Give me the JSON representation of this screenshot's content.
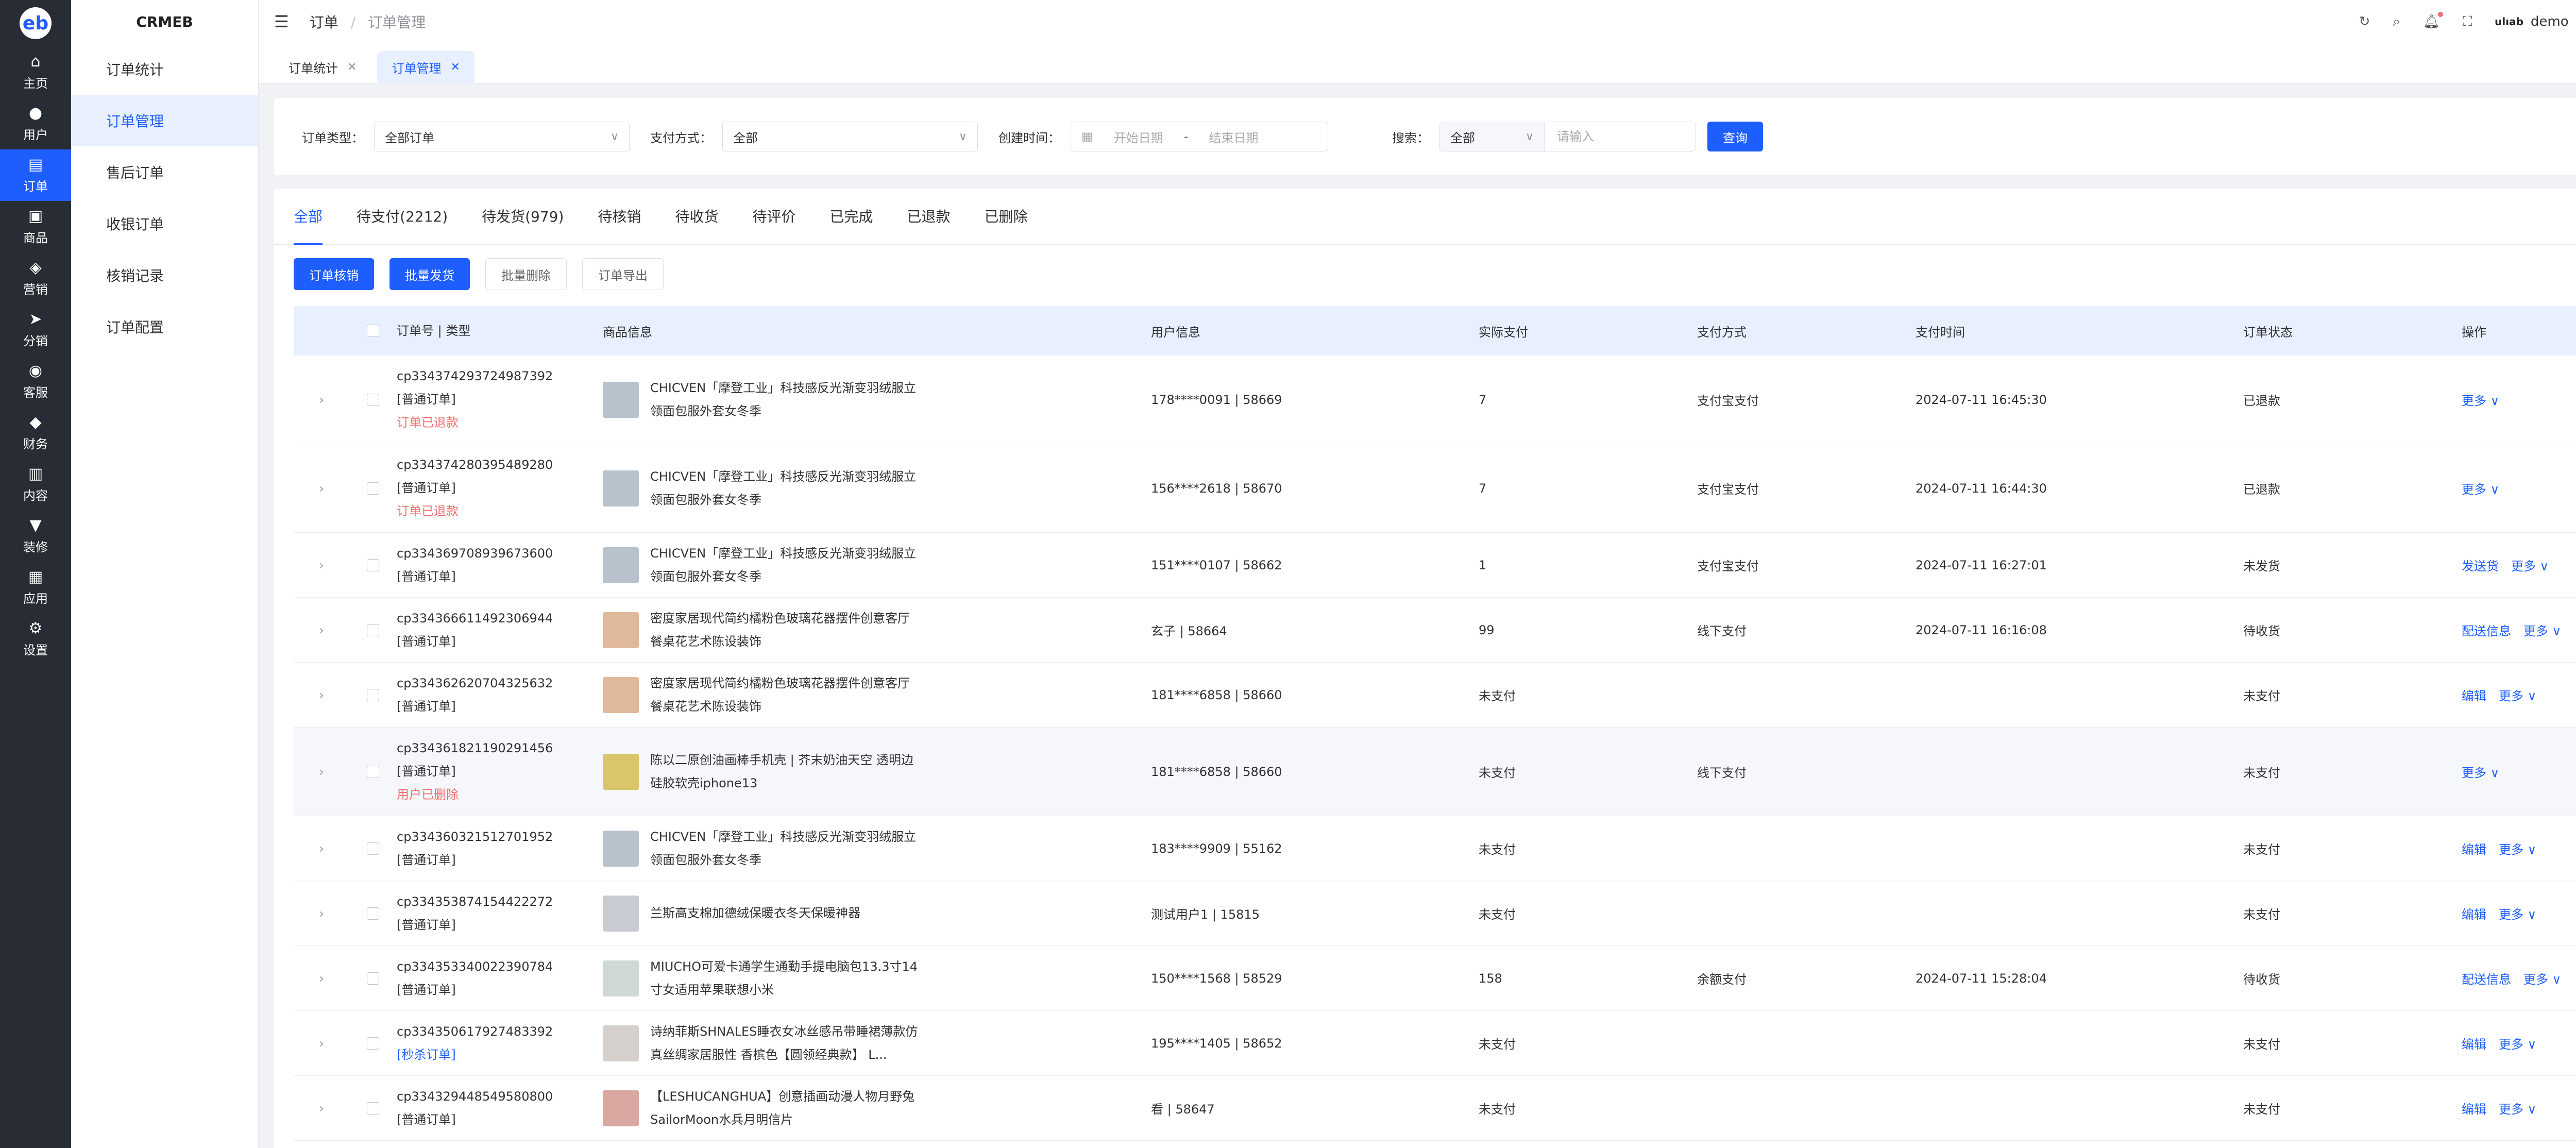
{
  "app": {
    "brand": "CRMEB",
    "logo": "eb"
  },
  "rail": [
    {
      "label": "主页",
      "icon": "⌂",
      "name": "home"
    },
    {
      "label": "用户",
      "icon": "●",
      "name": "user"
    },
    {
      "label": "订单",
      "icon": "▤",
      "name": "order"
    },
    {
      "label": "商品",
      "icon": "▣",
      "name": "goods"
    },
    {
      "label": "营销",
      "icon": "◈",
      "name": "marketing"
    },
    {
      "label": "分销",
      "icon": "➤",
      "name": "distribution"
    },
    {
      "label": "客服",
      "icon": "◉",
      "name": "service"
    },
    {
      "label": "财务",
      "icon": "◆",
      "name": "finance"
    },
    {
      "label": "内容",
      "icon": "▥",
      "name": "content"
    },
    {
      "label": "装修",
      "icon": "▼",
      "name": "decorate"
    },
    {
      "label": "应用",
      "icon": "▦",
      "name": "apps"
    },
    {
      "label": "设置",
      "icon": "⚙",
      "name": "settings"
    }
  ],
  "subnav": [
    "订单统计",
    "订单管理",
    "售后订单",
    "收银订单",
    "核销记录",
    "订单配置"
  ],
  "breadcrumb": {
    "root": "订单",
    "current": "订单管理",
    "sep": "/"
  },
  "header": {
    "username": "demo",
    "user_logo": "ulıab"
  },
  "tags": [
    {
      "label": "订单统计"
    },
    {
      "label": "订单管理"
    }
  ],
  "filter": {
    "type_label": "订单类型：",
    "type_value": "全部订单",
    "pay_label": "支付方式：",
    "pay_value": "全部",
    "time_label": "创建时间：",
    "start_placeholder": "开始日期",
    "dash": "-",
    "end_placeholder": "结束日期",
    "search_label": "搜索：",
    "search_scope": "全部",
    "search_placeholder": "请输入",
    "query_button": "查询"
  },
  "status_tabs": [
    "全部",
    "待支付(2212)",
    "待发货(979)",
    "待核销",
    "待收货",
    "待评价",
    "已完成",
    "已退款",
    "已删除"
  ],
  "buttons": {
    "verify": "订单核销",
    "batch_ship": "批量发货",
    "batch_delete": "批量删除",
    "export": "订单导出"
  },
  "columns": [
    "订单号 | 类型",
    "商品信息",
    "用户信息",
    "实际支付",
    "支付方式",
    "支付时间",
    "订单状态",
    "操作"
  ],
  "rows": [
    {
      "order": "cp334374293724987392",
      "type": "[普通订单]",
      "note": "订单已退款",
      "note_style": "red",
      "type_style": "",
      "goods": "CHICVEN「摩登工业」科技感反光渐变羽绒服立领面包服外套女冬季",
      "thumb": "#b8c2cc",
      "user": "178****0091 | 58669",
      "paid": "7",
      "method": "支付宝支付",
      "time": "2024-07-11 16:45:30",
      "status": "已退款",
      "ops": [
        "更多 ∨"
      ]
    },
    {
      "order": "cp334374280395489280",
      "type": "[普通订单]",
      "note": "订单已退款",
      "note_style": "red",
      "type_style": "",
      "goods": "CHICVEN「摩登工业」科技感反光渐变羽绒服立领面包服外套女冬季",
      "thumb": "#b8c2cc",
      "user": "156****2618 | 58670",
      "paid": "7",
      "method": "支付宝支付",
      "time": "2024-07-11 16:44:30",
      "status": "已退款",
      "ops": [
        "更多 ∨"
      ]
    },
    {
      "order": "cp334369708939673600",
      "type": "[普通订单]",
      "note": "",
      "note_style": "",
      "type_style": "",
      "goods": "CHICVEN「摩登工业」科技感反光渐变羽绒服立领面包服外套女冬季",
      "thumb": "#b8c2cc",
      "user": "151****0107 | 58662",
      "paid": "1",
      "method": "支付宝支付",
      "time": "2024-07-11 16:27:01",
      "status": "未发货",
      "ops": [
        "发送货",
        "更多 ∨"
      ]
    },
    {
      "order": "cp334366611492306944",
      "type": "[普通订单]",
      "note": "",
      "note_style": "",
      "type_style": "",
      "goods": "密度家居现代简约橘粉色玻璃花器摆件创意客厅餐桌花艺术陈设装饰",
      "thumb": "#e0b89a",
      "user": "玄子 | 58664",
      "paid": "99",
      "method": "线下支付",
      "time": "2024-07-11 16:16:08",
      "status": "待收货",
      "ops": [
        "配送信息",
        "更多 ∨"
      ]
    },
    {
      "order": "cp334362620704325632",
      "type": "[普通订单]",
      "note": "",
      "note_style": "",
      "type_style": "",
      "goods": "密度家居现代简约橘粉色玻璃花器摆件创意客厅餐桌花艺术陈设装饰",
      "thumb": "#e0b89a",
      "user": "181****6858 | 58660",
      "paid": "未支付",
      "method": "",
      "time": "",
      "status": "未支付",
      "ops": [
        "编辑",
        "更多 ∨"
      ]
    },
    {
      "order": "cp334361821190291456",
      "type": "[普通订单]",
      "note": "用户已删除",
      "note_style": "red",
      "type_style": "",
      "goods": "陈以二原创油画棒手机壳 | 芥末奶油天空 透明边硅胶软壳iphone13",
      "thumb": "#d9c66b",
      "user": "181****6858 | 58660",
      "paid": "未支付",
      "method": "线下支付",
      "time": "",
      "status": "未支付",
      "ops": [
        "更多 ∨"
      ],
      "hl": true
    },
    {
      "order": "cp334360321512701952",
      "type": "[普通订单]",
      "note": "",
      "note_style": "",
      "type_style": "",
      "goods": "CHICVEN「摩登工业」科技感反光渐变羽绒服立领面包服外套女冬季",
      "thumb": "#b8c2cc",
      "user": "183****9909 | 55162",
      "paid": "未支付",
      "method": "",
      "time": "",
      "status": "未支付",
      "ops": [
        "编辑",
        "更多 ∨"
      ]
    },
    {
      "order": "cp334353874154422272",
      "type": "[普通订单]",
      "note": "",
      "note_style": "",
      "type_style": "",
      "goods": "兰斯高支棉加德绒保暖衣冬天保暖神器",
      "thumb": "#c8ccd2",
      "user": "测试用户1 | 15815",
      "paid": "未支付",
      "method": "",
      "time": "",
      "status": "未支付",
      "ops": [
        "编辑",
        "更多 ∨"
      ]
    },
    {
      "order": "cp334353340022390784",
      "type": "[普通订单]",
      "note": "",
      "note_style": "",
      "type_style": "",
      "goods": "MIUCHO可爱卡通学生通勤手提电脑包13.3寸14寸女适用苹果联想小米",
      "thumb": "#cfd8d6",
      "user": "150****1568 | 58529",
      "paid": "158",
      "method": "余额支付",
      "time": "2024-07-11 15:28:04",
      "status": "待收货",
      "ops": [
        "配送信息",
        "更多 ∨"
      ]
    },
    {
      "order": "cp334350617927483392",
      "type": "[秒杀订单]",
      "note": "",
      "note_style": "",
      "type_style": "blue",
      "goods": "诗纳菲斯SHNALES睡衣女冰丝感吊带睡裙薄款仿真丝绸家居服性 香槟色【圆领经典款】 L...",
      "thumb": "#d6d0cc",
      "user": "195****1405 | 58652",
      "paid": "未支付",
      "method": "",
      "time": "",
      "status": "未支付",
      "ops": [
        "编辑",
        "更多 ∨"
      ]
    },
    {
      "order": "cp334329448549580800",
      "type": "[普通订单]",
      "note": "",
      "note_style": "",
      "type_style": "",
      "goods": "【LESHUCANGHUA】创意插画动漫人物月野兔SailorMoon水兵月明信片",
      "thumb": "#d9a8a0",
      "user": "看 | 58647",
      "paid": "未支付",
      "method": "",
      "time": "",
      "status": "未支付",
      "ops": [
        "编辑",
        "更多 ∨"
      ]
    }
  ],
  "row_heights": null
}
